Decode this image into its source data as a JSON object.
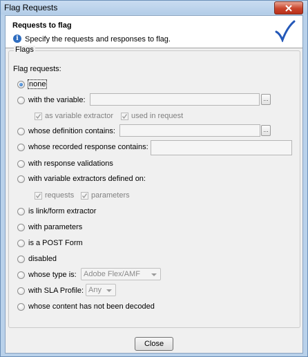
{
  "window": {
    "title": "Flag Requests"
  },
  "header": {
    "title": "Requests to flag",
    "description": "Specify the requests and responses to flag."
  },
  "group": {
    "label": "Flags",
    "intro": "Flag requests:"
  },
  "options": {
    "none": "none",
    "with_variable": "with the variable:",
    "definition_contains": "whose definition contains:",
    "response_contains": "whose recorded response contains:",
    "response_validations": "with response validations",
    "extractors_defined_on": "with variable extractors defined on:",
    "link_form_extractor": "is link/form extractor",
    "with_parameters": "with parameters",
    "post_form": "is a POST Form",
    "disabled": "disabled",
    "type_is": "whose type is:",
    "sla_profile": "with SLA Profile:",
    "not_decoded": "whose content has not been decoded"
  },
  "selected_option": "none",
  "sub_checks": {
    "as_variable_extractor": "as variable extractor",
    "used_in_request": "used in request",
    "requests": "requests",
    "parameters": "parameters"
  },
  "fields": {
    "variable_value": "",
    "definition_value": "",
    "response_value": "",
    "browse_label": "..."
  },
  "selects": {
    "type_value": "Adobe Flex/AMF",
    "sla_value": "Any"
  },
  "footer": {
    "close_label": "Close"
  },
  "colors": {
    "accent": "#1a5fb4",
    "checkmark": "#2458b8"
  }
}
